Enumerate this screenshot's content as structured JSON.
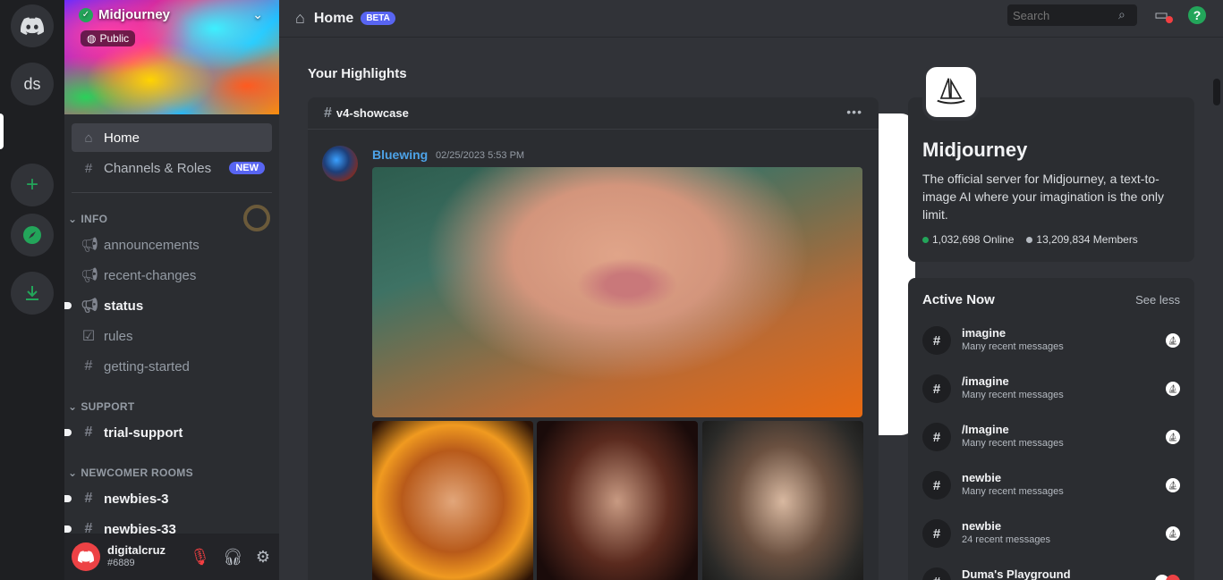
{
  "server": {
    "name": "Midjourney",
    "visibility": "Public"
  },
  "rail": {
    "items": [
      {
        "name": "discord-home",
        "label": ""
      },
      {
        "name": "ds",
        "label": "ds"
      },
      {
        "name": "midjourney",
        "label": ""
      },
      {
        "name": "add-server",
        "label": "+"
      },
      {
        "name": "explore",
        "label": ""
      },
      {
        "name": "download",
        "label": ""
      }
    ]
  },
  "nav": {
    "home": "Home",
    "channels_roles": "Channels & Roles",
    "new_badge": "NEW"
  },
  "categories": {
    "info": "INFO",
    "support": "SUPPORT",
    "newcomer": "NEWCOMER ROOMS"
  },
  "channels": {
    "announcements": "announcements",
    "recent_changes": "recent-changes",
    "status": "status",
    "rules": "rules",
    "getting_started": "getting-started",
    "trial_support": "trial-support",
    "newbies_3": "newbies-3",
    "newbies_33": "newbies-33"
  },
  "user": {
    "name": "digitalcruz",
    "tag": "#6889"
  },
  "topbar": {
    "title": "Home",
    "badge": "BETA",
    "search_placeholder": "Search"
  },
  "highlights": {
    "heading": "Your Highlights",
    "channel": "v4-showcase",
    "author": "Bluewing",
    "timestamp": "02/25/2023 5:53 PM"
  },
  "about": {
    "name": "Midjourney",
    "description": "The official server for Midjourney, a text-to-image AI where your imagination is the only limit.",
    "online": "1,032,698 Online",
    "members": "13,209,834 Members"
  },
  "active_now": {
    "title": "Active Now",
    "toggle": "See less",
    "items": [
      {
        "name": "imagine",
        "sub": "Many recent messages"
      },
      {
        "name": "/imagine",
        "sub": "Many recent messages"
      },
      {
        "name": "/Imagine",
        "sub": "Many recent messages"
      },
      {
        "name": "newbie",
        "sub": "Many recent messages"
      },
      {
        "name": "newbie",
        "sub": "24 recent messages"
      },
      {
        "name": "Duma's Playground",
        "sub": ""
      }
    ]
  },
  "colors": {
    "accent": "#5865f2",
    "online": "#23a55a",
    "danger": "#ed4245",
    "link": "#4da3e8"
  }
}
